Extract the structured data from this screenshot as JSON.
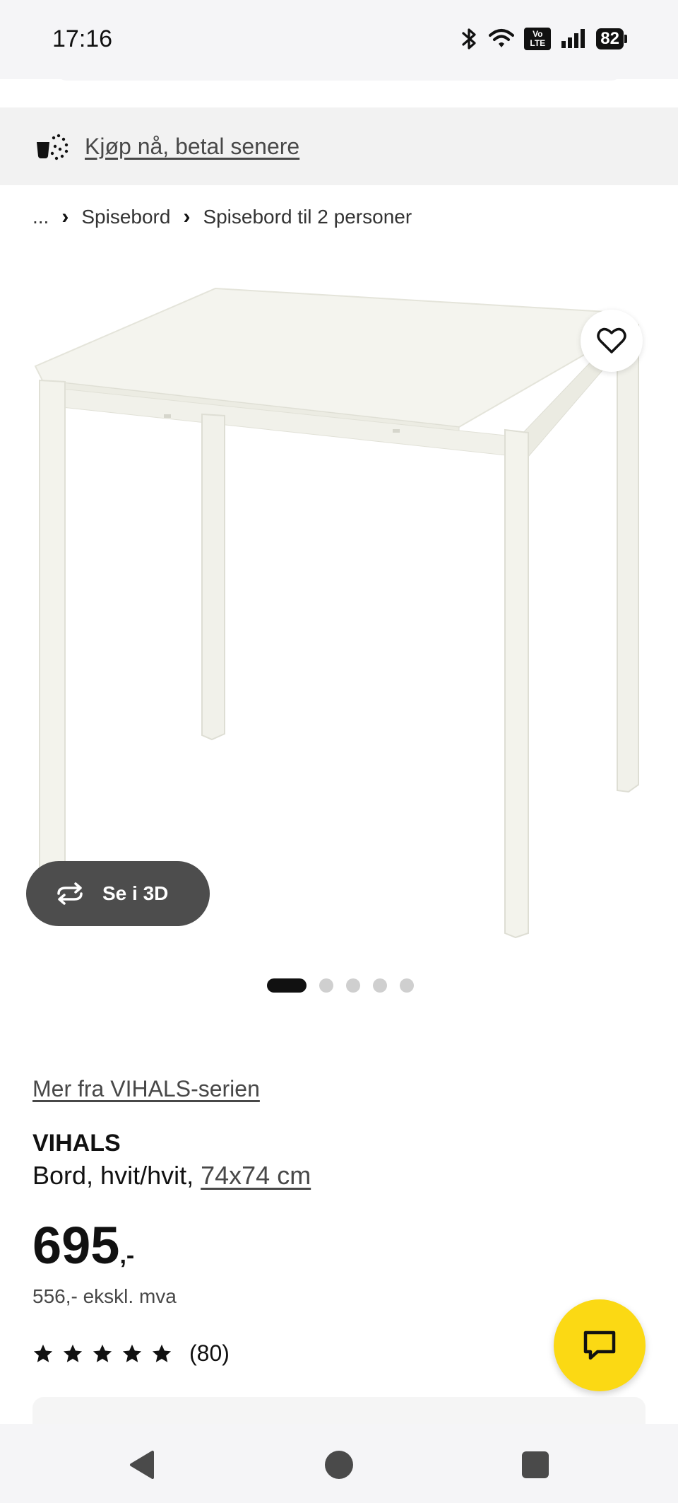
{
  "status_bar": {
    "time": "17:16",
    "volte_label": "Vo LTE",
    "battery": "82"
  },
  "promo": {
    "label": "Kjøp nå, betal senere"
  },
  "breadcrumb": {
    "ellipsis": "...",
    "items": [
      "Spisebord",
      "Spisebord til 2 personer"
    ]
  },
  "gallery": {
    "view_3d_label": "Se i 3D",
    "total_images": 5,
    "active_index": 0
  },
  "product": {
    "series_link": "Mer fra VIHALS-serien",
    "name": "VIHALS",
    "description": "Bord, hvit/hvit,",
    "size": "74x74 cm",
    "price": "695",
    "price_suffix": ",-",
    "price_excl_vat": "556,- ekskl. mva",
    "rating_stars": 5,
    "rating_count": "(80)"
  },
  "colors": {
    "accent_yellow": "#fbd914",
    "dark_button": "#4d4d4d",
    "promo_bg": "#f2f2f2"
  },
  "icons": {
    "promo": "pot-sparkle-icon",
    "favourite": "heart-icon",
    "view_3d": "rotate-icon",
    "chat": "chat-bubble-icon",
    "nav": [
      "back-triangle-icon",
      "home-circle-icon",
      "recent-square-icon"
    ]
  }
}
